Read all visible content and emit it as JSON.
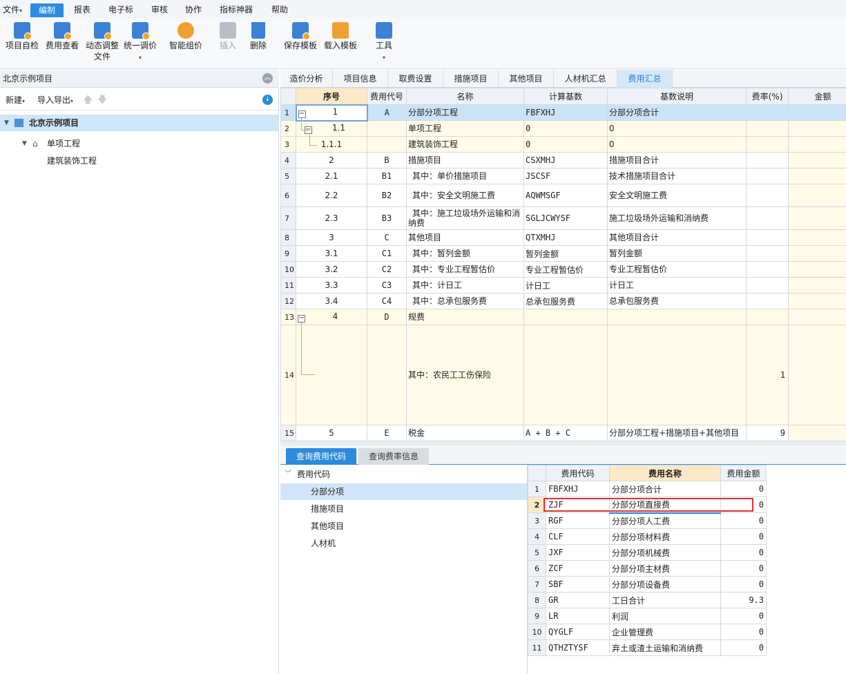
{
  "menu": {
    "items": [
      "文件",
      "编制",
      "报表",
      "电子标",
      "审核",
      "协作",
      "指标神器",
      "帮助"
    ],
    "active": "编制"
  },
  "ribbon": {
    "project_check": "项目自检",
    "fee_view": "费用查看",
    "dynamic_adjust_l1": "动态调整",
    "dynamic_adjust_l2": "文件",
    "unified_price": "统一调价",
    "smart_pricing": "智能组价",
    "insert": "插入",
    "delete": "删除",
    "save_template": "保存模板",
    "load_template": "载入模板",
    "tools": "工具"
  },
  "left_panel": {
    "title": "北京示例项目",
    "new_label": "新建",
    "import_export_label": "导入导出",
    "tree": {
      "root": "北京示例项目",
      "child": "单项工程",
      "grandchild": "建筑装饰工程"
    }
  },
  "tabs": [
    "造价分析",
    "项目信息",
    "取费设置",
    "措施项目",
    "其他项目",
    "人材机汇总",
    "费用汇总"
  ],
  "active_tab": "费用汇总",
  "grid": {
    "headers": [
      "序号",
      "费用代号",
      "名称",
      "计算基数",
      "基数说明",
      "费率(%)",
      "金额"
    ],
    "rows": [
      {
        "rn": "1",
        "seq": "1",
        "code": "A",
        "name": "分部分项工程",
        "base": "FBFXHJ",
        "desc": "分部分项合计",
        "rate": ""
      },
      {
        "rn": "2",
        "seq": "1.1",
        "code": "",
        "name": "单项工程",
        "base": "0",
        "desc": "0",
        "rate": ""
      },
      {
        "rn": "3",
        "seq": "1.1.1",
        "code": "",
        "name": "建筑装饰工程",
        "base": "0",
        "desc": "0",
        "rate": ""
      },
      {
        "rn": "4",
        "seq": "2",
        "code": "B",
        "name": "措施项目",
        "base": "CSXMHJ",
        "desc": "措施项目合计",
        "rate": ""
      },
      {
        "rn": "5",
        "seq": "2.1",
        "code": "B1",
        "name": "其中：单价措施项目",
        "base": "JSCSF",
        "desc": "技术措施项目合计",
        "rate": ""
      },
      {
        "rn": "6",
        "seq": "2.2",
        "code": "B2",
        "name": "其中：安全文明施工费",
        "base": "AQWMSGF",
        "desc": "安全文明施工费",
        "rate": ""
      },
      {
        "rn": "7",
        "seq": "2.3",
        "code": "B3",
        "name": "其中：施工垃圾场外运输和消纳费",
        "base": "SGLJCWYSF",
        "desc": "施工垃圾场外运输和消纳费",
        "rate": ""
      },
      {
        "rn": "8",
        "seq": "3",
        "code": "C",
        "name": "其他项目",
        "base": "QTXMHJ",
        "desc": "其他项目合计",
        "rate": ""
      },
      {
        "rn": "9",
        "seq": "3.1",
        "code": "C1",
        "name": "其中：暂列金额",
        "base": "暂列金额",
        "desc": "暂列金额",
        "rate": ""
      },
      {
        "rn": "10",
        "seq": "3.2",
        "code": "C2",
        "name": "其中：专业工程暂估价",
        "base": "专业工程暂估价",
        "desc": "专业工程暂估价",
        "rate": ""
      },
      {
        "rn": "11",
        "seq": "3.3",
        "code": "C3",
        "name": "其中：计日工",
        "base": "计日工",
        "desc": "计日工",
        "rate": ""
      },
      {
        "rn": "12",
        "seq": "3.4",
        "code": "C4",
        "name": "其中：总承包服务费",
        "base": "总承包服务费",
        "desc": "总承包服务费",
        "rate": ""
      },
      {
        "rn": "13",
        "seq": "4",
        "code": "D",
        "name": "规费",
        "base": "",
        "desc": "",
        "rate": ""
      },
      {
        "rn": "14",
        "seq": "",
        "code": "",
        "name": "其中：农民工工伤保险",
        "base": "",
        "desc": "",
        "rate": "1"
      },
      {
        "rn": "15",
        "seq": "5",
        "code": "E",
        "name": "税金",
        "base": "A + B + C",
        "desc": "分部分项工程+措施项目+其他项目",
        "rate": "9"
      }
    ]
  },
  "bottom_tabs": [
    "查询费用代码",
    "查询费率信息"
  ],
  "code_tree": {
    "root": "费用代码",
    "items": [
      "分部分项",
      "措施项目",
      "其他项目",
      "人材机"
    ],
    "selected": "分部分项"
  },
  "code_grid": {
    "headers": [
      "费用代码",
      "费用名称",
      "费用金额"
    ],
    "rows": [
      {
        "rn": "1",
        "code": "FBFXHJ",
        "name": "分部分项合计",
        "amount": "0"
      },
      {
        "rn": "2",
        "code": "ZJF",
        "name": "分部分项直接费",
        "amount": "0"
      },
      {
        "rn": "3",
        "code": "RGF",
        "name": "分部分项人工费",
        "amount": "0"
      },
      {
        "rn": "4",
        "code": "CLF",
        "name": "分部分项材料费",
        "amount": "0"
      },
      {
        "rn": "5",
        "code": "JXF",
        "name": "分部分项机械费",
        "amount": "0"
      },
      {
        "rn": "6",
        "code": "ZCF",
        "name": "分部分项主材费",
        "amount": "0"
      },
      {
        "rn": "7",
        "code": "SBF",
        "name": "分部分项设备费",
        "amount": "0"
      },
      {
        "rn": "8",
        "code": "GR",
        "name": "工日合计",
        "amount": "9.3"
      },
      {
        "rn": "9",
        "code": "LR",
        "name": "利润",
        "amount": "0"
      },
      {
        "rn": "10",
        "code": "QYGLF",
        "name": "企业管理费",
        "amount": "0"
      },
      {
        "rn": "11",
        "code": "QTHZTYSF",
        "name": "弃土或渣土运输和消纳费",
        "amount": "0"
      }
    ]
  },
  "colors": {
    "accent": "#2c8bdc",
    "highlight": "#fde9c7",
    "selection": "#cbe3f7",
    "annotation_box": "#e03030"
  }
}
